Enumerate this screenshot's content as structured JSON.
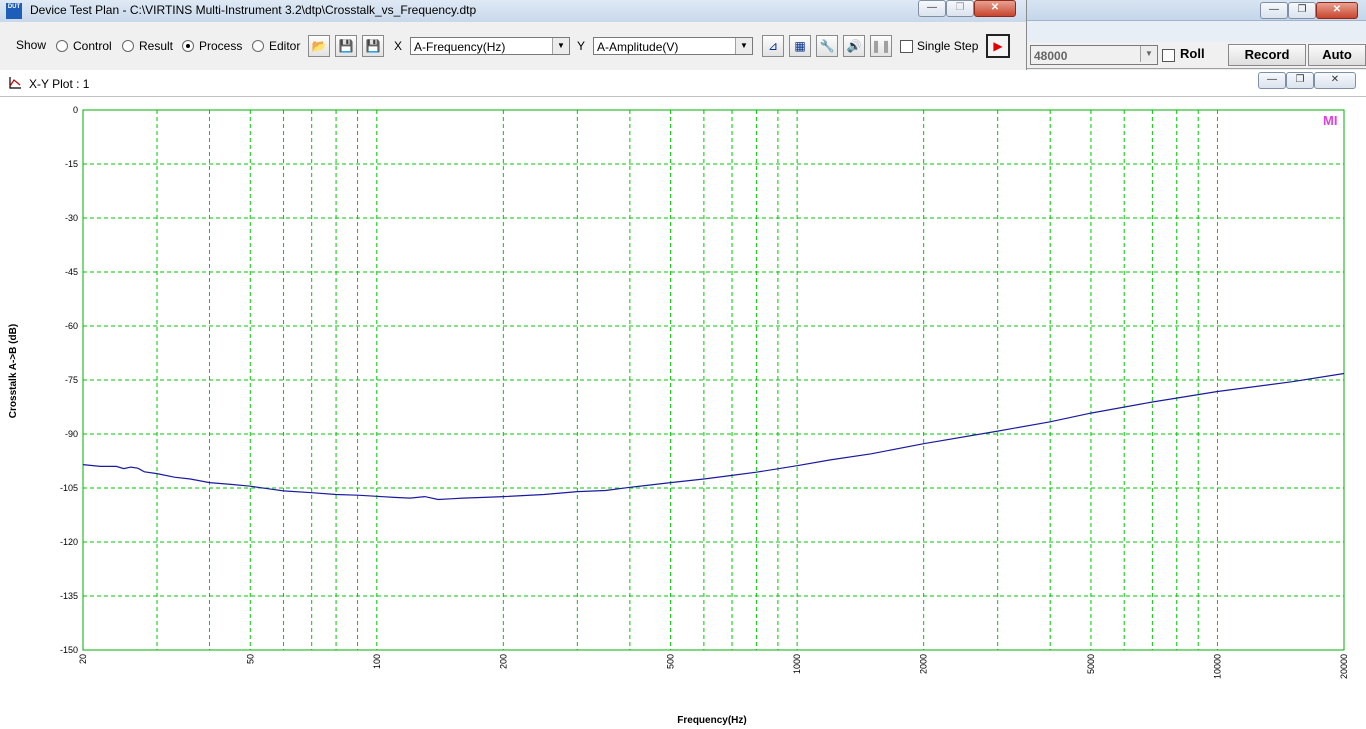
{
  "background_app": {
    "sample_rate": "48000",
    "roll_label": "Roll",
    "record_label": "Record",
    "auto_label": "Auto"
  },
  "device_test_plan": {
    "title": "Device Test Plan - C:\\VIRTINS Multi-Instrument 3.2\\dtp\\Crosstalk_vs_Frequency.dtp",
    "app_icon_text": "DUT",
    "show_label": "Show",
    "modes": [
      {
        "label": "Control",
        "selected": false
      },
      {
        "label": "Result",
        "selected": false
      },
      {
        "label": "Process",
        "selected": true
      },
      {
        "label": "Editor",
        "selected": false
      }
    ],
    "x_label": "X",
    "x_select": "A-Frequency(Hz)",
    "y_label": "Y",
    "y_select": "A-Amplitude(V)",
    "single_step_label": "Single Step"
  },
  "xy_plot": {
    "title": "X-Y Plot : 1",
    "watermark": "MI"
  },
  "colors": {
    "grid": "#00c800",
    "trace": "#1a1aa0",
    "watermark": "#e040e0",
    "plot_border": "#00b000"
  },
  "chart_data": {
    "type": "line",
    "x_scale": "log",
    "xlabel": "Frequency(Hz)",
    "ylabel": "Crosstalk A->B (dB)",
    "xlim": [
      20,
      20000
    ],
    "ylim": [
      -150,
      0
    ],
    "x_tick_labels": [
      "20",
      "50",
      "100",
      "200",
      "500",
      "1000",
      "2000",
      "5000",
      "10000",
      "20000"
    ],
    "x_ticks": [
      20,
      50,
      100,
      200,
      500,
      1000,
      2000,
      5000,
      10000,
      20000
    ],
    "y_ticks": [
      0,
      -15,
      -30,
      -45,
      -60,
      -75,
      -90,
      -105,
      -120,
      -135,
      -150
    ],
    "grid": true,
    "series": [
      {
        "x": [
          20,
          22,
          24,
          25,
          26,
          27,
          28,
          30,
          33,
          36,
          40,
          45,
          50,
          55,
          60,
          70,
          80,
          90,
          100,
          110,
          120,
          130,
          140,
          150,
          160,
          180,
          200,
          250,
          300,
          350,
          400,
          500,
          600,
          700,
          800,
          1000,
          1200,
          1500,
          2000,
          3000,
          4000,
          5000,
          7000,
          10000,
          15000,
          20000
        ],
        "y": [
          -98.5,
          -99,
          -99,
          -99.6,
          -99.2,
          -99.5,
          -100.5,
          -101,
          -102,
          -102.5,
          -103.5,
          -104,
          -104.5,
          -105.2,
          -105.8,
          -106.3,
          -106.8,
          -107,
          -107.3,
          -107.6,
          -107.8,
          -107.4,
          -108.2,
          -108,
          -107.8,
          -107.6,
          -107.4,
          -106.8,
          -106,
          -105.7,
          -104.8,
          -103.5,
          -102.5,
          -101.5,
          -100.6,
          -98.8,
          -97.2,
          -95.5,
          -92.7,
          -89.2,
          -86.6,
          -84.2,
          -81.1,
          -78.2,
          -75.5,
          -73.2
        ]
      }
    ]
  }
}
